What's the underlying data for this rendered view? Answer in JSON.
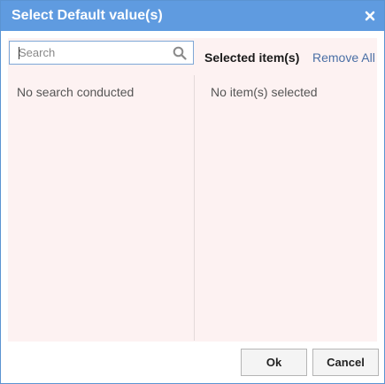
{
  "dialog": {
    "title": "Select Default value(s)",
    "close_icon": "close-icon"
  },
  "search": {
    "placeholder": "Search",
    "value": "",
    "icon": "search-icon",
    "empty_text": "No search conducted"
  },
  "selected": {
    "title": "Selected item(s)",
    "remove_all_label": "Remove All",
    "empty_text": "No item(s) selected"
  },
  "footer": {
    "ok_label": "Ok",
    "cancel_label": "Cancel"
  },
  "colors": {
    "titlebar": "#5f9be0",
    "panel_background": "#fdf2f2",
    "link": "#4a6fa5"
  }
}
